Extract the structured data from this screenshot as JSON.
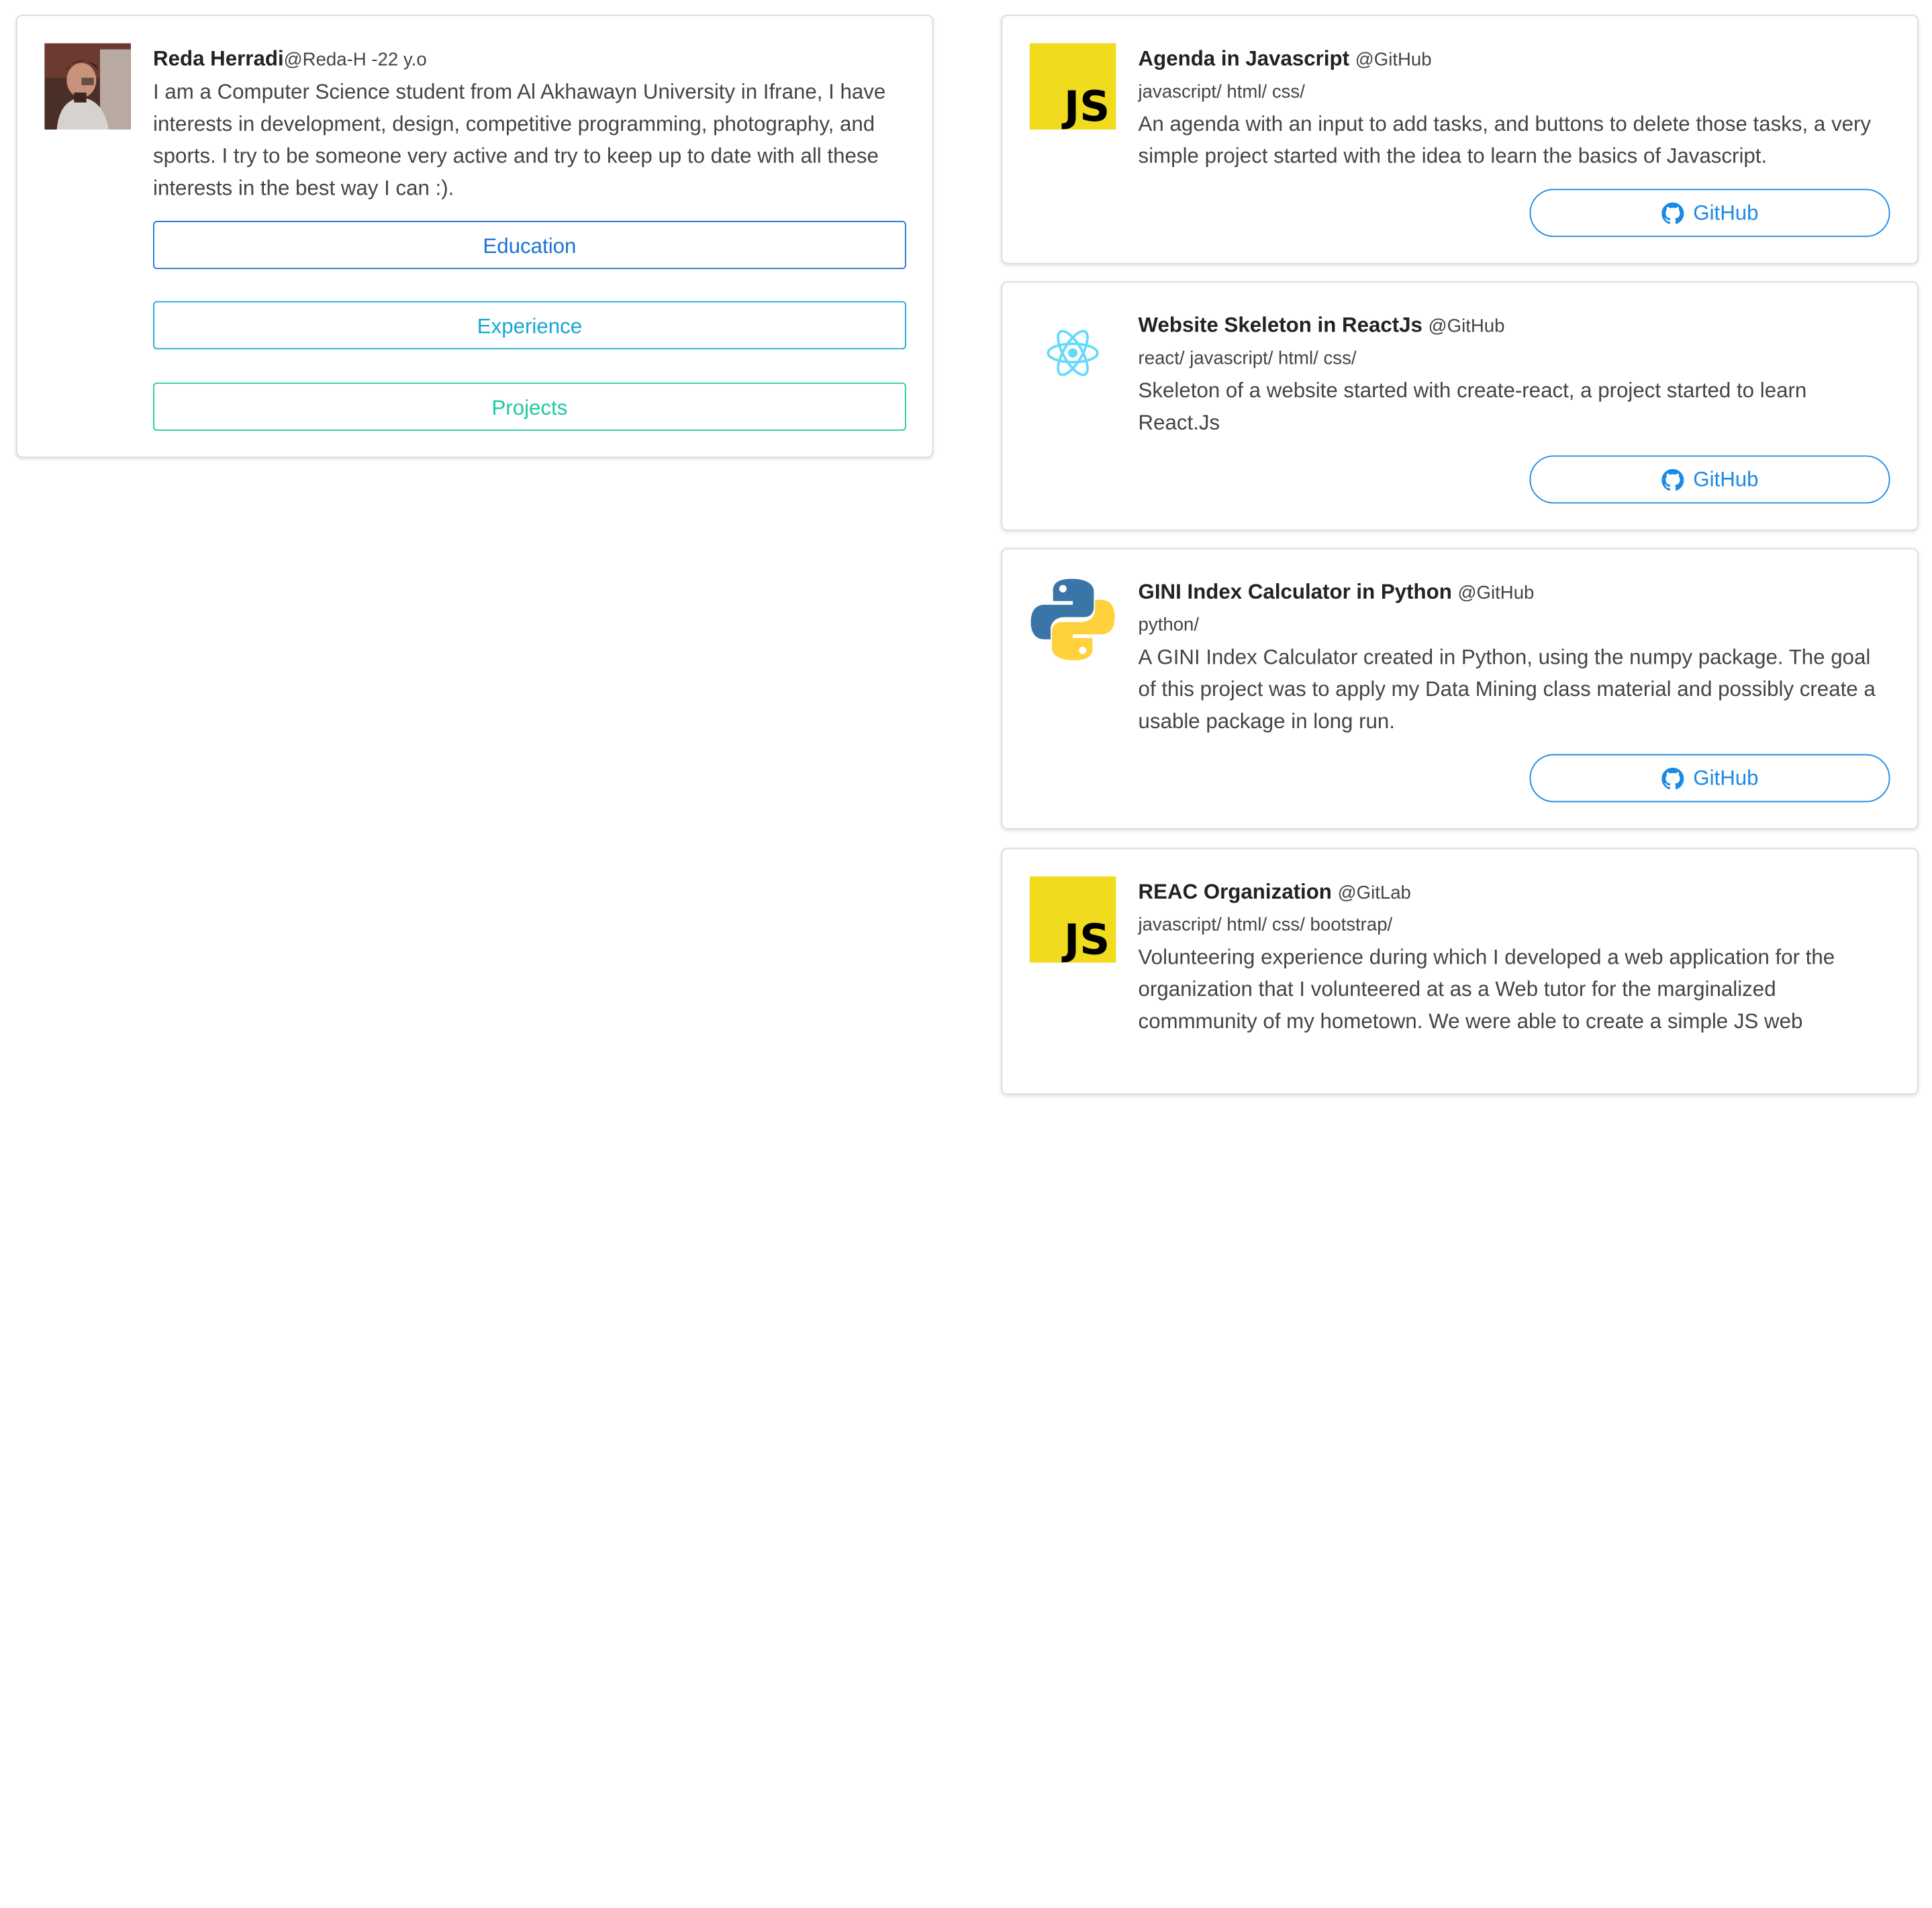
{
  "profile": {
    "name": "Reda Herradi",
    "handle": "@Reda-H -22 y.o",
    "bio": "I am a Computer Science student from Al Akhawayn University in Ifrane, I have interests in development, design, competitive programming, photography, and sports. I try to be someone very active and try to keep up to date with all these interests in the best way I can :).",
    "buttons": {
      "education": "Education",
      "experience": "Experience",
      "projects": "Projects"
    }
  },
  "projects": [
    {
      "logo": "js-logo",
      "title": "Agenda in Javascript",
      "platform": "@GitHub",
      "tags": "javascript/ html/ css/",
      "description": "An agenda with an input to add tasks, and buttons to delete those tasks, a very simple project started with the idea to learn the basics of Javascript.",
      "button": "GitHub"
    },
    {
      "logo": "react-logo",
      "title": "Website Skeleton in ReactJs",
      "platform": "@GitHub",
      "tags": "react/ javascript/ html/ css/",
      "description": "Skeleton of a website started with create-react, a project started to learn React.Js",
      "button": "GitHub"
    },
    {
      "logo": "python-logo",
      "title": "GINI Index Calculator in Python",
      "platform": "@GitHub",
      "tags": "python/",
      "description": "A GINI Index Calculator created in Python, using the numpy package. The goal of this project was to apply my Data Mining class material and possibly create a usable package in long run.",
      "button": "GitHub"
    },
    {
      "logo": "js-logo",
      "title": "REAC Organization",
      "platform": "@GitLab",
      "tags": "javascript/ html/ css/ bootstrap/",
      "description": "Volunteering experience during which I developed a web application for the organization that I volunteered at as a Web tutor for the marginalized commmunity of my hometown. We were able to create a simple JS web"
    }
  ],
  "js_logo_text": "JS",
  "colors": {
    "education": "#1a73d9",
    "experience": "#17a6d6",
    "projects": "#1fc8a4",
    "github_button": "#1a8ae6",
    "js_yellow": "#f0db1f",
    "react_blue": "#61dafb",
    "python_blue": "#3a75a8",
    "python_yellow": "#ffd13d"
  }
}
